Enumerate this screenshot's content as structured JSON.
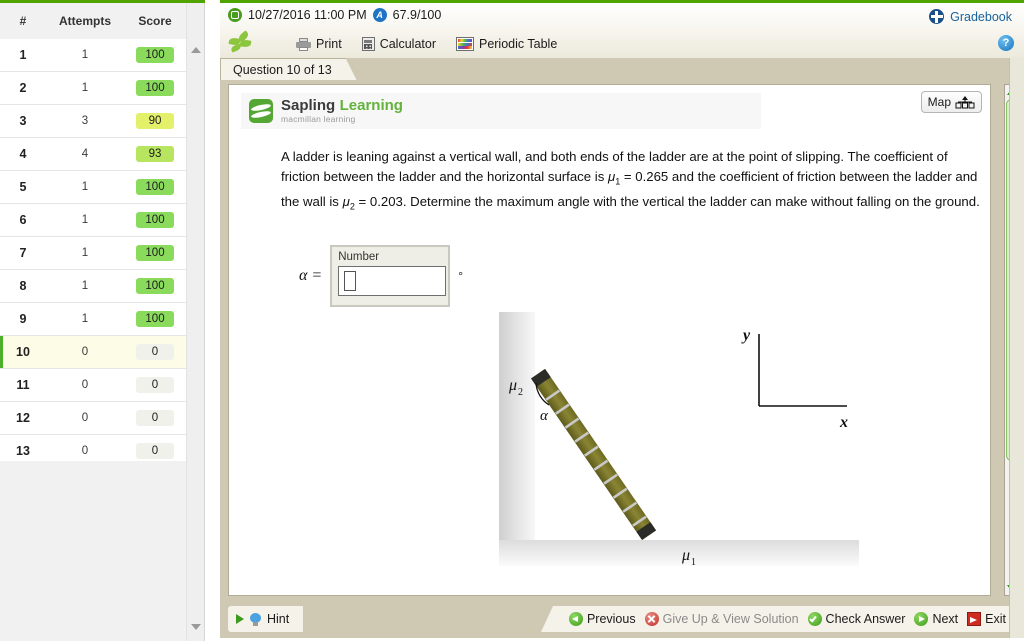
{
  "sidebar": {
    "columns": [
      "#",
      "Attempts",
      "Score"
    ],
    "rows": [
      {
        "num": "1",
        "attempts": "1",
        "score": "100",
        "color": "#8ada5c",
        "selected": false
      },
      {
        "num": "2",
        "attempts": "1",
        "score": "100",
        "color": "#8ada5c",
        "selected": false
      },
      {
        "num": "3",
        "attempts": "3",
        "score": "90",
        "color": "#e2f06a",
        "selected": false
      },
      {
        "num": "4",
        "attempts": "4",
        "score": "93",
        "color": "#b7e55f",
        "selected": false
      },
      {
        "num": "5",
        "attempts": "1",
        "score": "100",
        "color": "#8ada5c",
        "selected": false
      },
      {
        "num": "6",
        "attempts": "1",
        "score": "100",
        "color": "#8ada5c",
        "selected": false
      },
      {
        "num": "7",
        "attempts": "1",
        "score": "100",
        "color": "#8ada5c",
        "selected": false
      },
      {
        "num": "8",
        "attempts": "1",
        "score": "100",
        "color": "#8ada5c",
        "selected": false
      },
      {
        "num": "9",
        "attempts": "1",
        "score": "100",
        "color": "#8ada5c",
        "selected": false
      },
      {
        "num": "10",
        "attempts": "0",
        "score": "0",
        "color": "#f1f1ec",
        "selected": true
      },
      {
        "num": "11",
        "attempts": "0",
        "score": "0",
        "color": "#f1f1ec",
        "selected": false
      },
      {
        "num": "12",
        "attempts": "0",
        "score": "0",
        "color": "#f1f1ec",
        "selected": false
      },
      {
        "num": "13",
        "attempts": "0",
        "score": "0",
        "color": "#f1f1ec",
        "selected": false
      }
    ]
  },
  "topbar": {
    "due_date": "10/27/2016 11:00 PM",
    "grade": "67.9/100",
    "gradebook_label": "Gradebook",
    "help_glyph": "?",
    "tools": [
      {
        "label": "Print",
        "icon": "printer-icon"
      },
      {
        "label": "Calculator",
        "icon": "calculator-icon"
      },
      {
        "label": "Periodic Table",
        "icon": "periodic-table-icon"
      }
    ]
  },
  "tab": {
    "label": "Question 10 of 13"
  },
  "branding": {
    "name_part1": "Sapling",
    "name_part2": "Learning",
    "tagline": "macmillan learning",
    "accent": "#63b23b"
  },
  "content": {
    "map_label": "Map",
    "question": {
      "line1_a": "A ladder is leaning against a vertical wall, and both ends of the ladder are at the point of slipping. The coefficient of friction between the ladder and the horizontal surface is ",
      "mu1": "μ",
      "mu1_sub": "1",
      "line1_b": " = 0.265 and the coefficient of friction between the ladder and the wall is ",
      "mu2": "μ",
      "mu2_sub": "2",
      "line1_c": " = 0.203. Determine the maximum angle with the vertical the ladder can make without falling on the ground."
    },
    "answer": {
      "symbol": "α =",
      "box_label": "Number",
      "value": "",
      "unit": "°"
    },
    "figure": {
      "wall_label": "μ",
      "wall_label_sub": "2",
      "floor_label": "μ",
      "floor_label_sub": "1",
      "angle_label": "α",
      "axis_y": "y",
      "axis_x": "x",
      "ladder_color": "#7d7a2c"
    }
  },
  "actionbar": {
    "hint_label": "Hint",
    "buttons": [
      {
        "label": "Previous",
        "icon": "back-arrow-icon",
        "dim": false
      },
      {
        "label": "Give Up & View Solution",
        "icon": "cancel-icon",
        "dim": true
      },
      {
        "label": "Check Answer",
        "icon": "check-icon",
        "dim": false
      },
      {
        "label": "Next",
        "icon": "forward-arrow-icon",
        "dim": false
      },
      {
        "label": "Exit",
        "icon": "exit-icon",
        "dim": false
      }
    ]
  }
}
